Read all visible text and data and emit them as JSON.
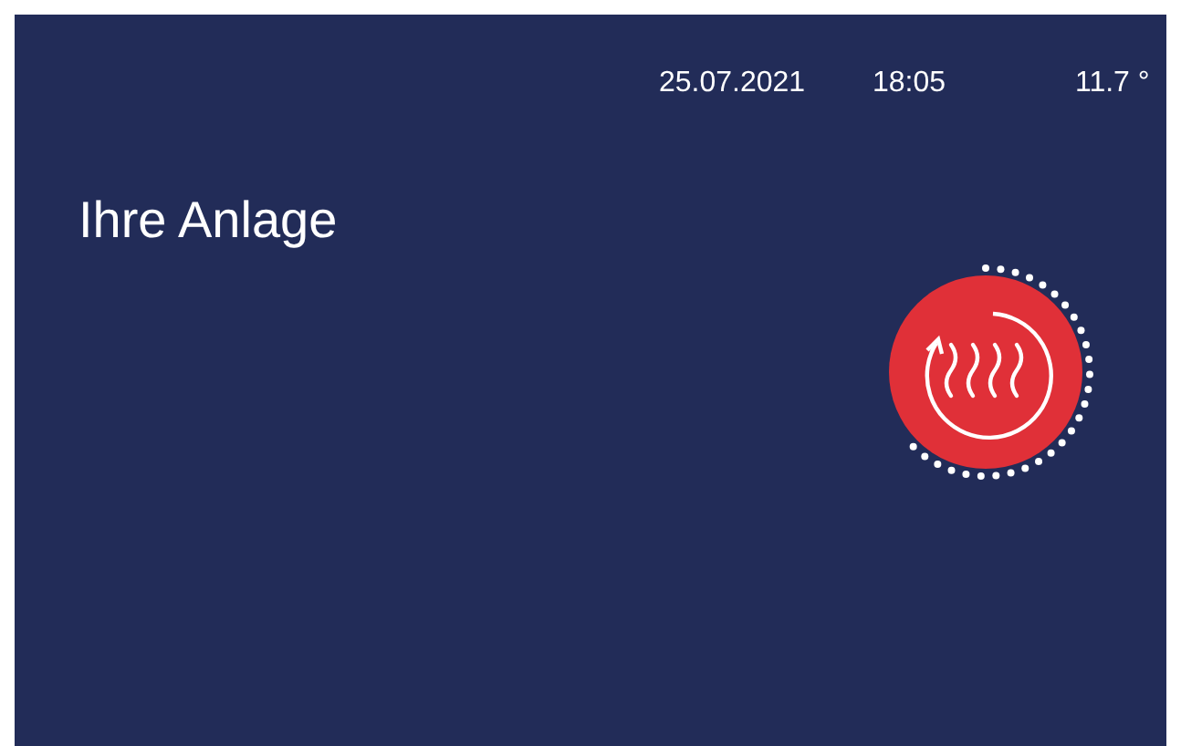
{
  "status_bar": {
    "date": "25.07.2021",
    "time": "18:05",
    "temperature": "11.7 °"
  },
  "title": "Ihre Anlage",
  "heating": {
    "active": true
  }
}
